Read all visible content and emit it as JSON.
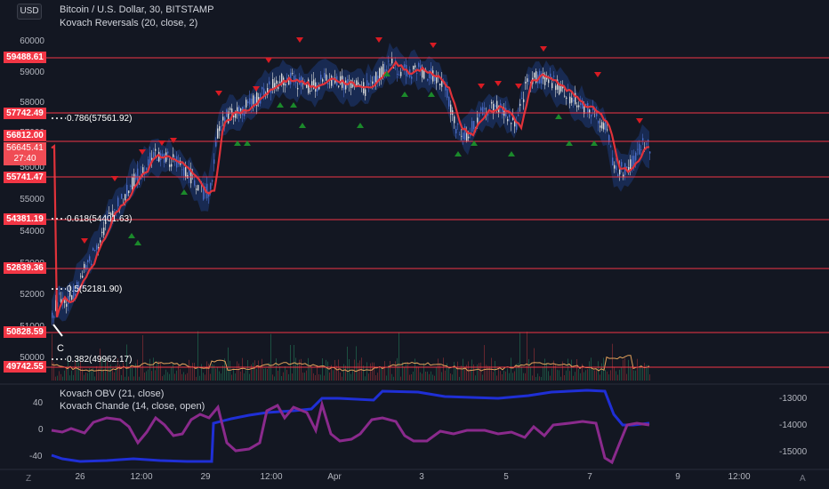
{
  "header": {
    "currency_button": "USD",
    "symbol_line": "Bitcoin / U.S. Dollar, 30, BITSTAMP",
    "indicator_line": "Kovach Reversals (20, close, 2)"
  },
  "price_axis": [
    "60000",
    "59000",
    "58000",
    "57000",
    "56000",
    "55000",
    "54000",
    "53000",
    "52000",
    "51000",
    "50000"
  ],
  "sr_levels": [
    "59488.61",
    "57742.49",
    "56812.00",
    "55741.47",
    "54381.19",
    "52839.36",
    "50828.59",
    "49742.55"
  ],
  "current_price": {
    "price": "56645.41",
    "countdown": "27:40"
  },
  "fib_levels": [
    {
      "label": "0.786(57561.92)"
    },
    {
      "label": "0.618(54401.63)"
    },
    {
      "label": "0.5(52181.90)"
    },
    {
      "label": "0.382(49962.17)"
    }
  ],
  "wave_label": "C",
  "oscillator": {
    "legend_obv": "Kovach OBV (21, close)",
    "legend_chande": "Kovach Chande (14, close, open)",
    "left_axis": [
      "40",
      "0",
      "-40"
    ],
    "right_axis": [
      "-13000",
      "-14000",
      "-15000"
    ]
  },
  "time_axis": [
    "26",
    "12:00",
    "29",
    "12:00",
    "Apr",
    "3",
    "5",
    "7",
    "9",
    "12:00"
  ],
  "corner": {
    "left": "Z",
    "right": "A"
  },
  "colors": {
    "background": "#131722",
    "support_resistance": "#f23645",
    "moving_average": "#e0323a",
    "band": "#1e3a7a",
    "up_marker": "#1b8a2b",
    "down_marker": "#d81b23",
    "obv": "#1f2fd6",
    "chande": "#8a2a8c",
    "volume_line": "#e3a15b"
  },
  "icons": {
    "reversal_up": "green-triangle-up",
    "reversal_down": "red-triangle-down"
  }
}
